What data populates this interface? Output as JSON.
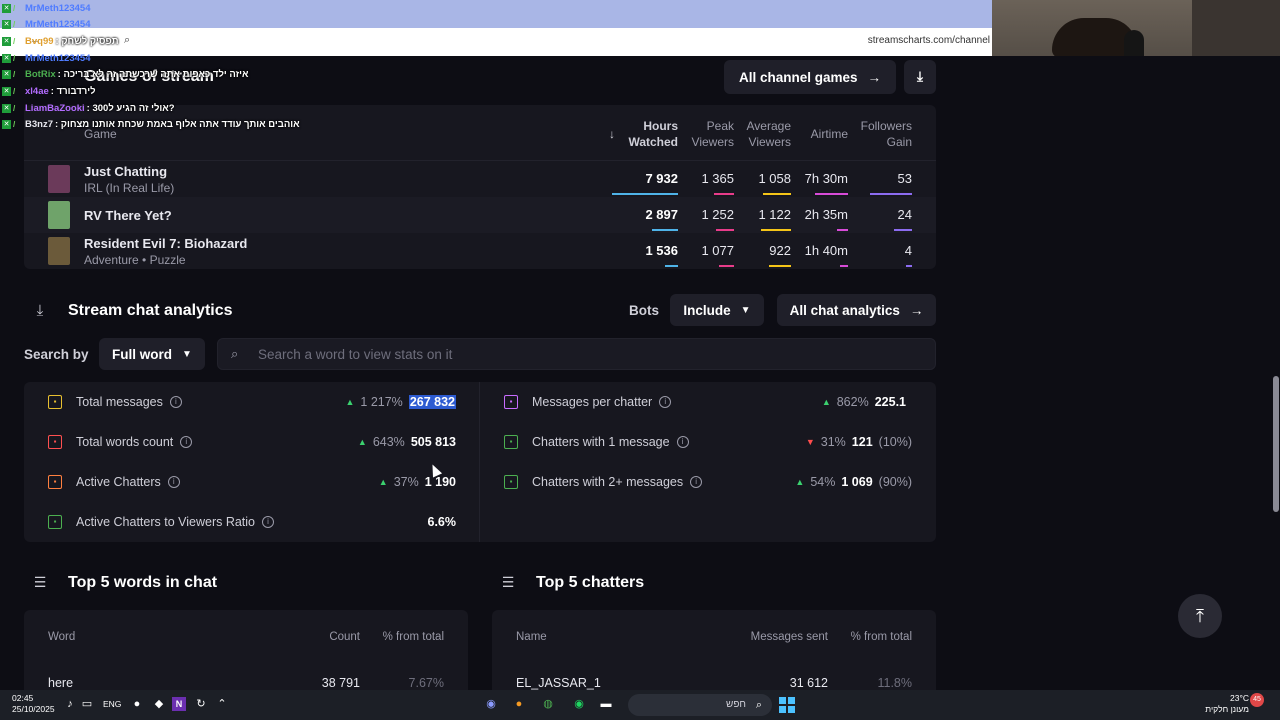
{
  "browser": {
    "url": "streamscharts.com/channel",
    "back_icon": "arrow-left-icon",
    "search_icon": "magnifier-icon"
  },
  "chat_overlay": [
    {
      "user": "MrMeth123454",
      "message": "",
      "color": "#4f7cff"
    },
    {
      "user": "MrMeth123454",
      "message": "",
      "color": "#4f7cff"
    },
    {
      "user": "Bvq99",
      "message": "תפסיק לשחק",
      "color": "#e0a030"
    },
    {
      "user": "MrMeth123454",
      "message": "",
      "color": "#4f7cff"
    },
    {
      "user": "BotRix",
      "message": "איזה ילד כאפות אתה שרכשתה זה לא בריכה",
      "color": "#4caf50"
    },
    {
      "user": "xl4ae",
      "message": "לירדבורד",
      "color": "#b36cff"
    },
    {
      "user": "LiamBaZooki",
      "message": "אולי זה הגיע ל300?",
      "color": "#b36cff"
    },
    {
      "user": "B3nz7",
      "message": "אוהבים אותך עודד אתה אלוף באמת שכחת אותנו מצחוק",
      "color": "#e8e8ef"
    }
  ],
  "games": {
    "title": "Games of stream",
    "all_button": "All channel games",
    "columns": {
      "game": "Game",
      "hours_watched": [
        "Hours",
        "Watched"
      ],
      "peak_viewers": [
        "Peak",
        "Viewers"
      ],
      "average_viewers": [
        "Average",
        "Viewers"
      ],
      "airtime": "Airtime",
      "followers_gain": [
        "Followers",
        "Gain"
      ]
    },
    "rows": [
      {
        "name": "Just Chatting",
        "sub": "IRL (In Real Life)",
        "hours": "7 932",
        "peak": "1 365",
        "avg": "1 058",
        "airtime": "7h 30m",
        "followers": "53",
        "thumb": "#6b3a5a",
        "bars": [
          1.0,
          0.4,
          0.5,
          0.6,
          0.7
        ]
      },
      {
        "name": "RV There Yet?",
        "sub": "",
        "hours": "2 897",
        "peak": "1 252",
        "avg": "1 122",
        "airtime": "2h 35m",
        "followers": "24",
        "thumb": "#6fa36a",
        "bars": [
          0.4,
          0.35,
          0.55,
          0.2,
          0.3
        ]
      },
      {
        "name": "Resident Evil 7: Biohazard",
        "sub": "Adventure • Puzzle",
        "hours": "1 536",
        "peak": "1 077",
        "avg": "922",
        "airtime": "1h 40m",
        "followers": "4",
        "thumb": "#6b5a3a",
        "bars": [
          0.2,
          0.3,
          0.4,
          0.15,
          0.1
        ]
      }
    ],
    "bar_colors": [
      "#4fb3e8",
      "#e83c8a",
      "#f5c518",
      "#d84bd8",
      "#8c6cf0"
    ]
  },
  "chat_analytics": {
    "title": "Stream chat analytics",
    "bots_label": "Bots",
    "bots_value": "Include",
    "all_button": "All chat analytics",
    "search_by_label": "Search by",
    "search_by_value": "Full word",
    "search_placeholder": "Search a word to view stats on it",
    "left_stats": [
      {
        "label": "Total messages",
        "dir": "up",
        "change": "1 217%",
        "value": "267 832",
        "icon_color": "#e8c030",
        "highlight": true
      },
      {
        "label": "Total words count",
        "dir": "up",
        "change": "643%",
        "value": "505 813",
        "icon_color": "#ff5050",
        "highlight": false
      },
      {
        "label": "Active Chatters",
        "dir": "up",
        "change": "37%",
        "value": "1 190",
        "icon_color": "#ff8040",
        "highlight": false
      },
      {
        "label": "Active Chatters to Viewers Ratio",
        "dir": "",
        "change": "",
        "value": "6.6%",
        "icon_color": "#4caf50",
        "highlight": false
      }
    ],
    "right_stats": [
      {
        "label": "Messages per chatter",
        "dir": "up",
        "change": "862%",
        "value": "225.1",
        "pct": "",
        "icon_color": "#c86cff"
      },
      {
        "label": "Chatters with 1 message",
        "dir": "down",
        "change": "31%",
        "value": "121",
        "pct": "(10%)",
        "icon_color": "#4caf50"
      },
      {
        "label": "Chatters with 2+ messages",
        "dir": "up",
        "change": "54%",
        "value": "1 069",
        "pct": "(90%)",
        "icon_color": "#4caf50"
      }
    ]
  },
  "top_words": {
    "title": "Top 5 words in chat",
    "columns": [
      "Word",
      "Count",
      "% from total"
    ],
    "first_row": [
      "here",
      "38 791",
      "7.67%"
    ]
  },
  "top_chatters": {
    "title": "Top 5 chatters",
    "columns": [
      "Name",
      "Messages sent",
      "% from total"
    ],
    "first_row": [
      "EL_JASSAR_1",
      "31 612",
      "11.8%"
    ]
  },
  "taskbar": {
    "time": "02:45",
    "date": "25/10/2025",
    "lang": "ENG",
    "search_text": "חפש",
    "temp": "23°C",
    "weather": "מעונן חלקית",
    "notifications": "45"
  }
}
